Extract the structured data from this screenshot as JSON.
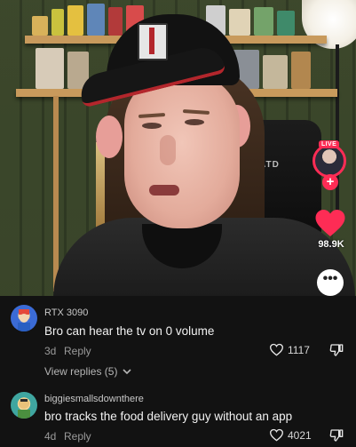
{
  "video": {
    "live_badge": "LIVE",
    "follow_icon": "+",
    "like_count": "98.9K",
    "chair_text": "ATD",
    "more_icon": "•••",
    "colors": {
      "accent": "#fe2c55",
      "heart": "#fe2c55"
    }
  },
  "comments": [
    {
      "username": "RTX 3090",
      "text": "Bro can hear the tv on 0 volume",
      "age": "3d",
      "reply_label": "Reply",
      "likes": "1117",
      "view_replies": "View replies (5)"
    },
    {
      "username": "biggiesmallsdownthere",
      "text": "bro tracks the food delivery guy without an app",
      "age": "4d",
      "reply_label": "Reply",
      "likes": "4021"
    }
  ]
}
